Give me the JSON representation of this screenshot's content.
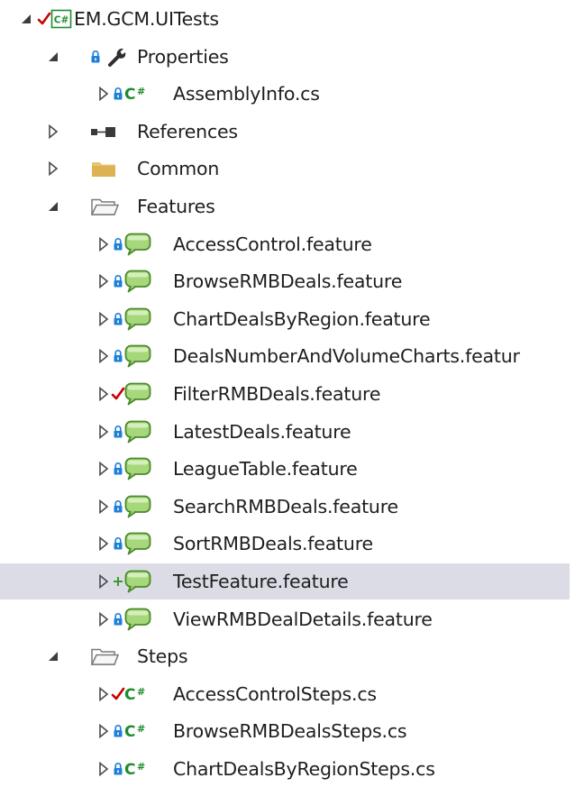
{
  "tree": {
    "selected_index": 15,
    "items": [
      {
        "label": "EM.GCM.UITests",
        "depth": 0,
        "expander": "expanded",
        "status": "check",
        "icon": "csharp-project-icon"
      },
      {
        "label": "Properties",
        "depth": 1,
        "expander": "expanded",
        "status": "lock",
        "icon": "wrench-icon"
      },
      {
        "label": "AssemblyInfo.cs",
        "depth": 2,
        "expander": "collapsed",
        "status": "lock",
        "icon": "csharp-file-icon"
      },
      {
        "label": "References",
        "depth": 1,
        "expander": "collapsed",
        "status": "none",
        "icon": "references-icon"
      },
      {
        "label": "Common",
        "depth": 1,
        "expander": "collapsed",
        "status": "none",
        "icon": "folder-closed-icon"
      },
      {
        "label": "Features",
        "depth": 1,
        "expander": "expanded",
        "status": "none",
        "icon": "folder-open-icon"
      },
      {
        "label": "AccessControl.feature",
        "depth": 2,
        "expander": "collapsed",
        "status": "lock",
        "icon": "feature-file-icon"
      },
      {
        "label": "BrowseRMBDeals.feature",
        "depth": 2,
        "expander": "collapsed",
        "status": "lock",
        "icon": "feature-file-icon"
      },
      {
        "label": "ChartDealsByRegion.feature",
        "depth": 2,
        "expander": "collapsed",
        "status": "lock",
        "icon": "feature-file-icon"
      },
      {
        "label": "DealsNumberAndVolumeCharts.featur",
        "depth": 2,
        "expander": "collapsed",
        "status": "lock",
        "icon": "feature-file-icon"
      },
      {
        "label": "FilterRMBDeals.feature",
        "depth": 2,
        "expander": "collapsed",
        "status": "check",
        "icon": "feature-file-icon"
      },
      {
        "label": "LatestDeals.feature",
        "depth": 2,
        "expander": "collapsed",
        "status": "lock",
        "icon": "feature-file-icon"
      },
      {
        "label": "LeagueTable.feature",
        "depth": 2,
        "expander": "collapsed",
        "status": "lock",
        "icon": "feature-file-icon"
      },
      {
        "label": "SearchRMBDeals.feature",
        "depth": 2,
        "expander": "collapsed",
        "status": "lock",
        "icon": "feature-file-icon"
      },
      {
        "label": "SortRMBDeals.feature",
        "depth": 2,
        "expander": "collapsed",
        "status": "lock",
        "icon": "feature-file-icon"
      },
      {
        "label": "TestFeature.feature",
        "depth": 2,
        "expander": "collapsed",
        "status": "plus",
        "icon": "feature-file-icon"
      },
      {
        "label": "ViewRMBDealDetails.feature",
        "depth": 2,
        "expander": "collapsed",
        "status": "lock",
        "icon": "feature-file-icon"
      },
      {
        "label": "Steps",
        "depth": 1,
        "expander": "expanded",
        "status": "none",
        "icon": "folder-open-icon"
      },
      {
        "label": "AccessControlSteps.cs",
        "depth": 2,
        "expander": "collapsed",
        "status": "check",
        "icon": "csharp-file-icon"
      },
      {
        "label": "BrowseRMBDealsSteps.cs",
        "depth": 2,
        "expander": "collapsed",
        "status": "lock",
        "icon": "csharp-file-icon"
      },
      {
        "label": "ChartDealsByRegionSteps.cs",
        "depth": 2,
        "expander": "collapsed",
        "status": "lock",
        "icon": "csharp-file-icon"
      }
    ]
  },
  "colors": {
    "selection": "#dcdce6",
    "check": "#c80000",
    "lock": "#1e7fd8",
    "plus": "#3c9a2a",
    "csharp": "#1e8c2e",
    "folder": "#e8c572"
  }
}
